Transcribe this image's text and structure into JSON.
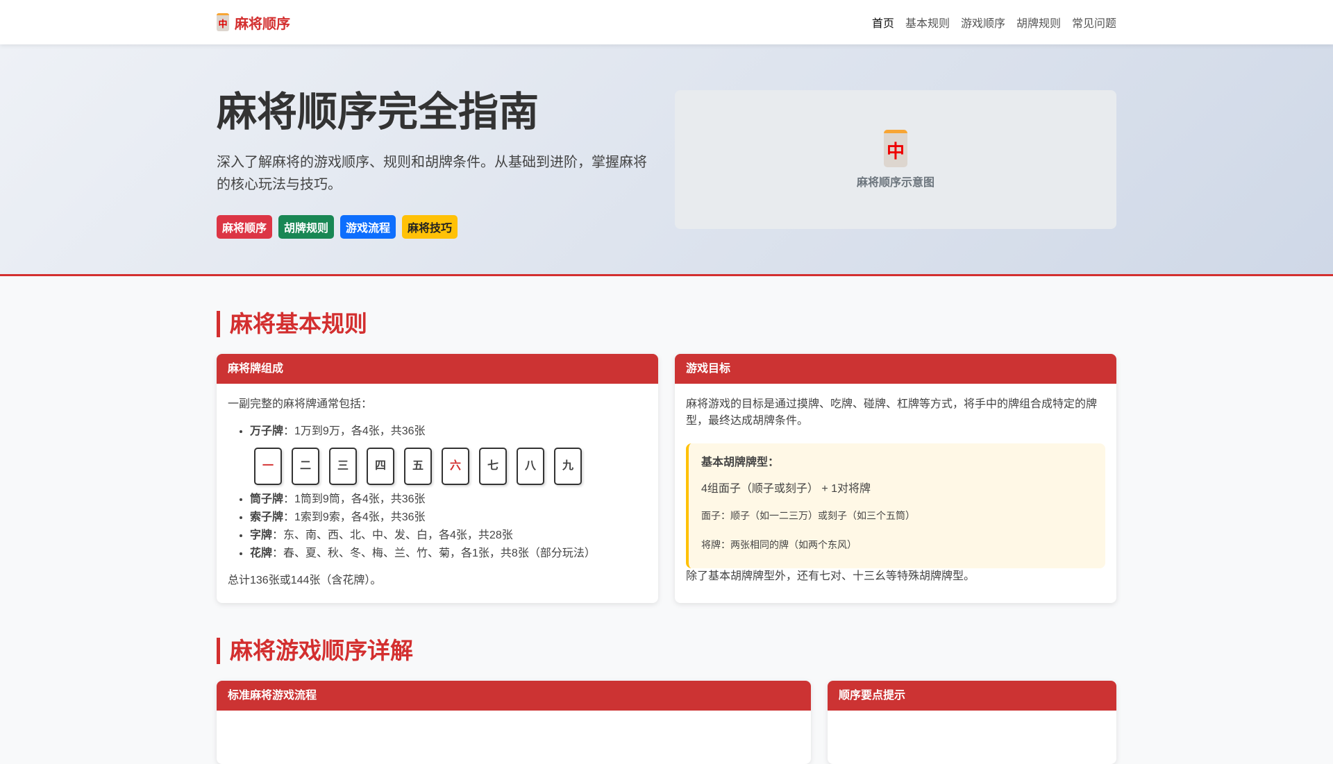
{
  "nav": {
    "brand": "麻将顺序",
    "tile_glyph": "中",
    "items": [
      "首页",
      "基本规则",
      "游戏顺序",
      "胡牌规则",
      "常见问题"
    ]
  },
  "hero": {
    "title": "麻将顺序完全指南",
    "desc": "深入了解麻将的游戏顺序、规则和胡牌条件。从基础到进阶，掌握麻将的核心玩法与技巧。",
    "tags": [
      {
        "label": "麻将顺序",
        "color": "#dc3545"
      },
      {
        "label": "胡牌规则",
        "color": "#198754"
      },
      {
        "label": "游戏流程",
        "color": "#0d6efd"
      },
      {
        "label": "麻将技巧",
        "color": "#ffc107"
      }
    ],
    "image_caption": "麻将顺序示意图",
    "image_glyph": "中"
  },
  "section1": {
    "title": "麻将基本规则",
    "card1": {
      "header": "麻将牌组成",
      "intro": "一副完整的麻将牌通常包括：",
      "items": [
        {
          "b": "万子牌",
          "t": "：1万到9万，各4张，共36张"
        },
        {
          "b": "筒子牌",
          "t": "：1筒到9筒，各4张，共36张"
        },
        {
          "b": "索子牌",
          "t": "：1索到9索，各4张，共36张"
        },
        {
          "b": "字牌",
          "t": "：东、南、西、北、中、发、白，各4张，共28张"
        },
        {
          "b": "花牌",
          "t": "：春、夏、秋、冬、梅、兰、竹、菊，各1张，共8张（部分玩法）"
        }
      ],
      "tiles": [
        "一",
        "二",
        "三",
        "四",
        "五",
        "六",
        "七",
        "八",
        "九"
      ],
      "total": "总计136张或144张（含花牌）。"
    },
    "card2": {
      "header": "游戏目标",
      "desc": "麻将游戏的目标是通过摸牌、吃牌、碰牌、杠牌等方式，将手中的牌组合成特定的牌型，最终达成胡牌条件。",
      "note_title": "基本胡牌牌型：",
      "note_formula": "4组面子（顺子或刻子） + 1对将牌",
      "note_line1": "面子：顺子（如一二三万）或刻子（如三个五筒）",
      "note_line2": "将牌：两张相同的牌（如两个东风）",
      "footer": "除了基本胡牌牌型外，还有七对、十三幺等特殊胡牌牌型。"
    }
  },
  "section2": {
    "title": "麻将游戏顺序详解",
    "card1_header": "标准麻将游戏流程",
    "card2_header": "顺序要点提示"
  }
}
